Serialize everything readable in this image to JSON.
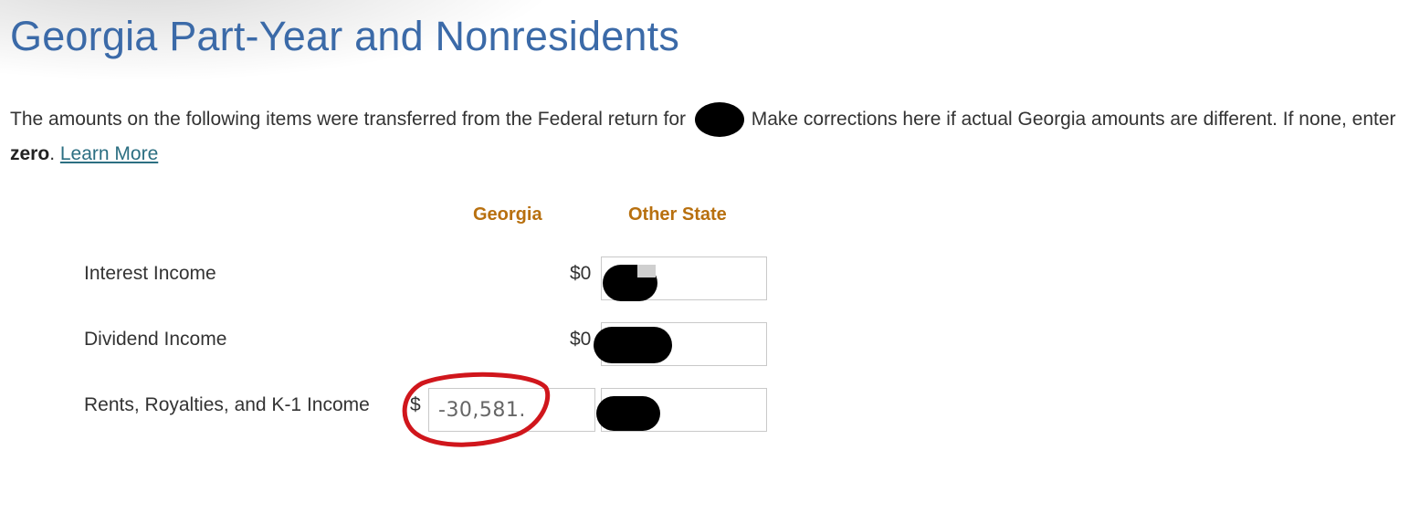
{
  "header": {
    "title": "Georgia Part-Year and Nonresidents"
  },
  "intro": {
    "text_before": "The amounts on the following items were transferred from the Federal return for",
    "text_after": "Make corrections here if actual Georgia amounts are different. If none, enter",
    "bold_word": "zero",
    "period": ".",
    "learn_more": "Learn More"
  },
  "columns": {
    "georgia": "Georgia",
    "other_state": "Other State"
  },
  "rows": [
    {
      "label": "Interest Income",
      "georgia_value": "$0",
      "other_state_value": ""
    },
    {
      "label": "Dividend Income",
      "georgia_value": "$0",
      "other_state_value": ""
    },
    {
      "label": "Rents, Royalties, and K-1 Income",
      "currency": "$",
      "georgia_value": "-30,581.",
      "other_state_value": ""
    }
  ],
  "colors": {
    "title": "#3b6aa8",
    "column_header": "#b8700f",
    "link": "#2c6f82",
    "annotation_circle": "#d0161c"
  }
}
